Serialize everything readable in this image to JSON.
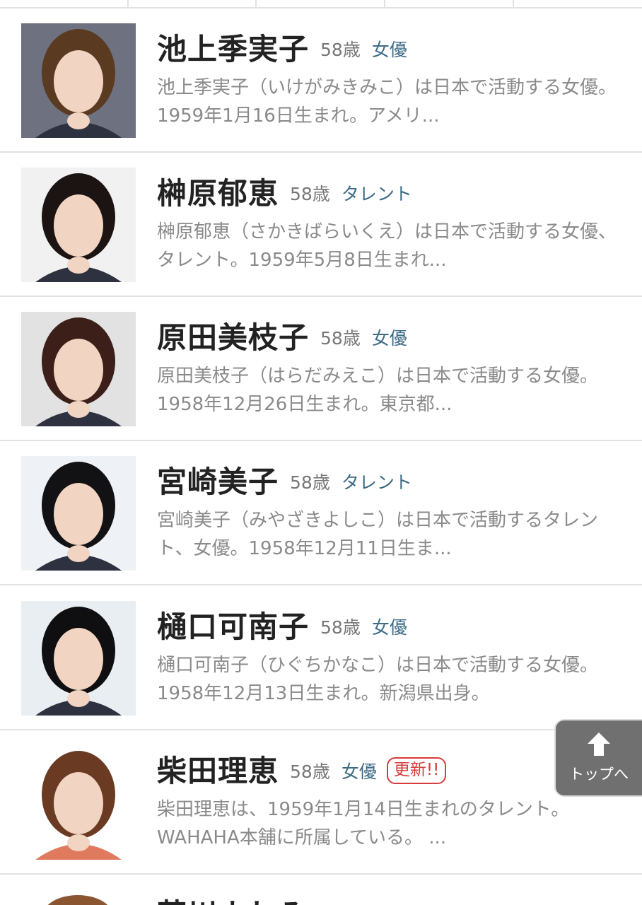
{
  "people": [
    {
      "name": "池上季実子",
      "age": "58歳",
      "category": "女優",
      "badge": null,
      "description": "池上季実子（いけがみきみこ）は日本で活動する女優。1959年1月16日生まれ。アメリ...",
      "photo_bg": "#6d7180",
      "hair": "#5b3a22"
    },
    {
      "name": "榊原郁恵",
      "age": "58歳",
      "category": "タレント",
      "badge": null,
      "description": "榊原郁恵（さかきばらいくえ）は日本で活動する女優、タレント。1959年5月8日生まれ...",
      "photo_bg": "#f1f1f1",
      "hair": "#1b1412"
    },
    {
      "name": "原田美枝子",
      "age": "58歳",
      "category": "女優",
      "badge": null,
      "description": "原田美枝子（はらだみえこ）は日本で活動する女優。1958年12月26日生まれ。東京都...",
      "photo_bg": "#e2e2e2",
      "hair": "#3b1f18"
    },
    {
      "name": "宮崎美子",
      "age": "58歳",
      "category": "タレント",
      "badge": null,
      "description": "宮崎美子（みやざきよしこ）は日本で活動するタレント、女優。1958年12月11日生ま...",
      "photo_bg": "#eef1f5",
      "hair": "#121114"
    },
    {
      "name": "樋口可南子",
      "age": "58歳",
      "category": "女優",
      "badge": null,
      "description": "樋口可南子（ひぐちかなこ）は日本で活動する女優。1958年12月13日生まれ。新潟県出身。",
      "photo_bg": "#e8eef2",
      "hair": "#0f0e10"
    },
    {
      "name": "柴田理恵",
      "age": "58歳",
      "category": "女優",
      "badge": "更新!!",
      "description": "柴田理恵は、1959年1月14日生まれのタレント。WAHAHA本舗に所属している。 ...",
      "photo_bg": "#ffffff",
      "hair": "#6b3a22"
    }
  ],
  "next_partial": {
    "name": "芸川よしみ"
  },
  "back_to_top": {
    "label": "トップへ",
    "icon": "arrow-up-icon"
  },
  "colors": {
    "category": "#3d6b86",
    "badge": "#d83b3b",
    "desc": "#8a8a8a"
  }
}
